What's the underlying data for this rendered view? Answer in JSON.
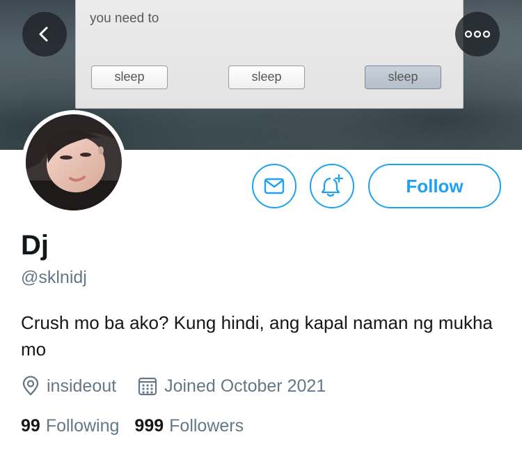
{
  "banner": {
    "dialog_text": "you need to",
    "dialog_buttons": [
      "sleep",
      "sleep",
      "sleep"
    ]
  },
  "nav": {
    "back_icon": "chevron-left-icon",
    "more_icon": "more-horizontal-icon"
  },
  "profile": {
    "display_name": "Dj",
    "handle": "@sklnidj",
    "bio": "Crush mo ba ako? Kung hindi, ang kapal naman ng mukha mo",
    "location": "insideout",
    "joined": "Joined October 2021",
    "following_count": "99",
    "following_label": "Following",
    "followers_count": "999",
    "followers_label": "Followers"
  },
  "actions": {
    "follow_label": "Follow",
    "message_icon": "envelope-icon",
    "notify_icon": "bell-plus-icon"
  },
  "colors": {
    "accent": "#1da1f2",
    "secondary_text": "#657786",
    "primary_text": "#14171a"
  }
}
